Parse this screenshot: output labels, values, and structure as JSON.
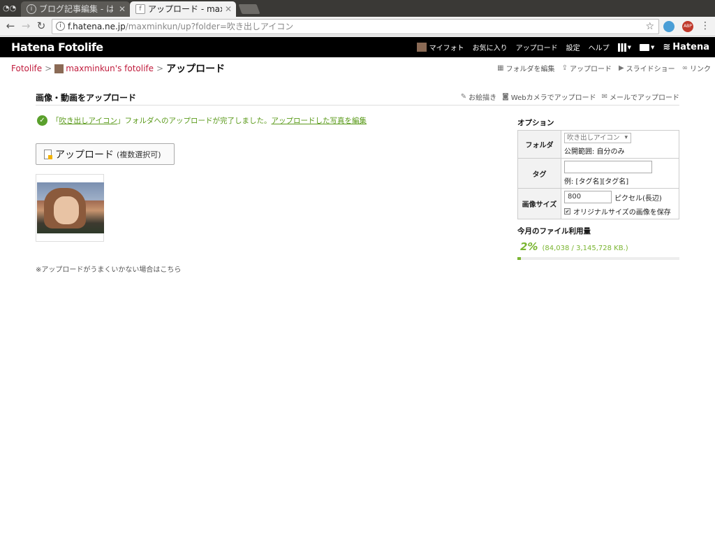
{
  "browser": {
    "tabs": [
      {
        "title": "ブログ記事編集 - は",
        "active": false
      },
      {
        "title": "アップロード - maxmi",
        "active": true
      }
    ],
    "url_host": "f.hatena.ne.jp",
    "url_path": "/maxminkun/up?folder=吹き出しアイコン",
    "ext_badge": "ABP"
  },
  "header": {
    "logo": "Hatena Fotolife",
    "nav": {
      "myfoto": "マイフォト",
      "favorites": "お気に入り",
      "upload": "アップロード",
      "settings": "設定",
      "help": "ヘルプ",
      "brand": "Hatena"
    }
  },
  "breadcrumb": {
    "root": "Fotolife",
    "user": "maxminkun's fotolife",
    "current": "アップロード",
    "sep": ">"
  },
  "toplinks": {
    "edit_folder": "フォルダを編集",
    "upload": "アップロード",
    "slideshow": "スライドショー",
    "link": "リンク"
  },
  "main": {
    "title": "画像・動画をアップロード",
    "links": {
      "draw": "お絵描き",
      "webcam": "Webカメラでアップロード",
      "mail": "メールでアップロード"
    },
    "notice": {
      "open_q": "「",
      "folder": "吹き出しアイコン",
      "mid": "」フォルダへのアップロードが完了しました。",
      "edit_link": "アップロードした写真を編集"
    },
    "upload_button": {
      "label": "アップロード",
      "sub": "(複数選択可)"
    },
    "help_text": "※アップロードがうまくいかない場合はこちら"
  },
  "options": {
    "heading": "オプション",
    "folder_label": "フォルダ",
    "folder_value": "吹き出しアイコン",
    "visibility": "公開範囲: 自分のみ",
    "tag_label": "タグ",
    "tag_value": "",
    "tag_example": "例: [タグ名][タグ名]",
    "size_label": "画像サイズ",
    "size_value": "800",
    "size_unit": "ピクセル(長辺)",
    "keep_original": "オリジナルサイズの画像を保存",
    "keep_original_checked": true
  },
  "usage": {
    "heading": "今月のファイル利用量",
    "percent": "2%",
    "percent_value": 2,
    "bytes": "(84,038 / 3,145,728 KB.)",
    "accent": "#7ab531"
  }
}
